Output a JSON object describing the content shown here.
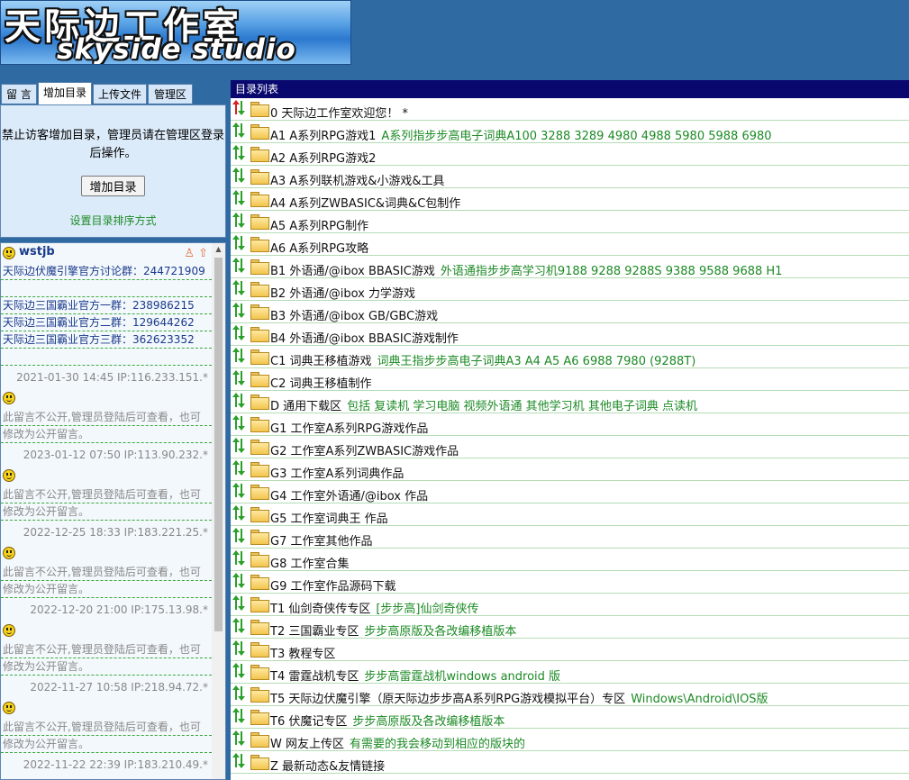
{
  "header": {
    "logo_cn": "天际边工作室",
    "logo_en": "skyside studio",
    "sub_text": "天际边工作室"
  },
  "tabs": [
    "留 言",
    "增加目录",
    "上传文件",
    "管理区"
  ],
  "add_panel": {
    "message": "禁止访客增加目录，管理员请在管理区登录后操作。",
    "button": "增加目录",
    "sort_link": "设置目录排序方式"
  },
  "guestbook": {
    "first": {
      "name": "wstjb",
      "lines": [
        "天际边伏魔引擎官方讨论群：244721909",
        "",
        "天际边三国霸业官方一群：238986215",
        "天际边三国霸业官方二群：129644262",
        "天际边三国霸业官方三群：362623352",
        ""
      ],
      "meta": "2021-01-30 14:45 IP:116.233.151.*"
    },
    "private_lines": [
      "此留言不公开,管理员登陆后可查看，也可",
      "修改为公开留言。"
    ],
    "private_metas": [
      "2023-01-12 07:50 IP:113.90.232.*",
      "2022-12-25 18:33 IP:183.221.25.*",
      "2022-12-20 21:00 IP:175.13.98.*",
      "2022-11-27 10:58 IP:218.94.72.*",
      "2022-11-22 22:39 IP:183.210.49.*"
    ]
  },
  "directory": {
    "title": "目录列表",
    "rows": [
      {
        "name": "0 天际边工作室欢迎您！ *",
        "desc": ""
      },
      {
        "name": "A1 A系列RPG游戏1",
        "desc": "A系列指步步高电子词典A100 3288 3289 4980 4988 5980 5988 6980"
      },
      {
        "name": "A2 A系列RPG游戏2",
        "desc": ""
      },
      {
        "name": "A3 A系列联机游戏&小游戏&工具",
        "desc": ""
      },
      {
        "name": "A4 A系列ZWBASIC&词典&C包制作",
        "desc": ""
      },
      {
        "name": "A5 A系列RPG制作",
        "desc": ""
      },
      {
        "name": "A6 A系列RPG攻略",
        "desc": ""
      },
      {
        "name": "B1 外语通/@ibox BBASIC游戏",
        "desc": "外语通指步步高学习机9188 9288 9288S 9388 9588 9688 H1"
      },
      {
        "name": "B2 外语通/@ibox 力学游戏",
        "desc": ""
      },
      {
        "name": "B3 外语通/@ibox GB/GBC游戏",
        "desc": ""
      },
      {
        "name": "B4 外语通/@ibox BBASIC游戏制作",
        "desc": ""
      },
      {
        "name": "C1 词典王移植游戏",
        "desc": "词典王指步步高电子词典A3 A4 A5 A6 6988 7980 (9288T)"
      },
      {
        "name": "C2 词典王移植制作",
        "desc": ""
      },
      {
        "name": "D 通用下载区",
        "desc": "包括 复读机 学习电脑 视频外语通 其他学习机 其他电子词典 点读机"
      },
      {
        "name": "G1 工作室A系列RPG游戏作品",
        "desc": ""
      },
      {
        "name": "G2 工作室A系列ZWBASIC游戏作品",
        "desc": ""
      },
      {
        "name": "G3 工作室A系列词典作品",
        "desc": ""
      },
      {
        "name": "G4 工作室外语通/@ibox 作品",
        "desc": ""
      },
      {
        "name": "G5 工作室词典王 作品",
        "desc": ""
      },
      {
        "name": "G7 工作室其他作品",
        "desc": ""
      },
      {
        "name": "G8 工作室合集",
        "desc": ""
      },
      {
        "name": "G9 工作室作品源码下载",
        "desc": ""
      },
      {
        "name": "T1 仙剑奇侠传专区",
        "desc": "[步步高]仙剑奇侠传"
      },
      {
        "name": "T2 三国霸业专区",
        "desc": "步步高原版及各改编移植版本"
      },
      {
        "name": "T3 教程专区",
        "desc": ""
      },
      {
        "name": "T4 雷霆战机专区",
        "desc": "步步高雷霆战机windows android 版"
      },
      {
        "name": "T5 天际边伏魔引擎（原天际边步步高A系列RPG游戏模拟平台）专区",
        "desc": "Windows\\Android\\IOS版"
      },
      {
        "name": "T6 伏魔记专区",
        "desc": "步步高原版及各改编移植版本"
      },
      {
        "name": "W 网友上传区",
        "desc": "有需要的我会移动到相应的版块的"
      },
      {
        "name": "Z 最新动态&友情链接",
        "desc": ""
      }
    ]
  },
  "colors": {
    "bg": "#2f6aa3",
    "title_bar": "#08086e",
    "green_text": "#1b8a24",
    "arrow_red": "#d42020",
    "arrow_green": "#2aa02a"
  }
}
